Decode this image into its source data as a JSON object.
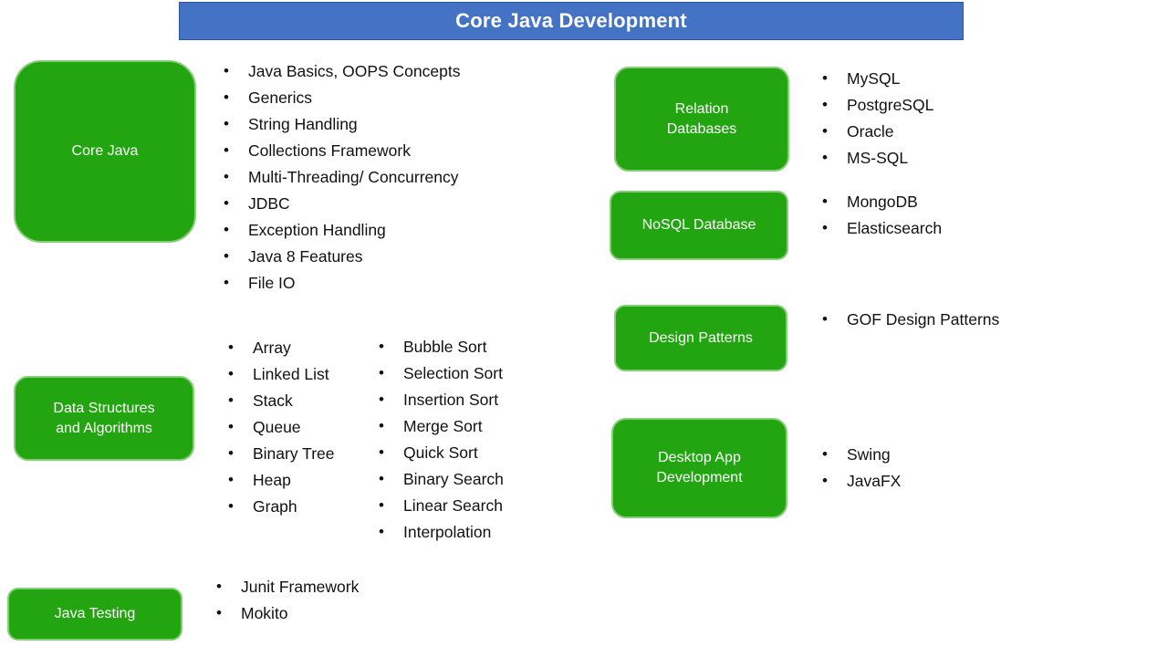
{
  "header": {
    "title": "Core Java Development",
    "background_color": "#4472c4",
    "text_color": "#ffffff"
  },
  "theme": {
    "box_fill": "#22a510",
    "box_border": "#86cd78",
    "box_text": "#ffffff",
    "body_text": "#111111",
    "page_background": "#ffffff"
  },
  "sections": [
    {
      "id": "core-java",
      "box_label": "Core Java",
      "items": [
        "Java Basics, OOPS Concepts",
        "Generics",
        "String Handling",
        "Collections Framework",
        "Multi-Threading/ Concurrency",
        "JDBC",
        "Exception Handling",
        "Java 8 Features",
        "File IO"
      ]
    },
    {
      "id": "data-structures-and-algorithms",
      "box_label": "Data Structures\nand Algorithms",
      "items": [
        "Array",
        "Linked List",
        "Stack",
        "Queue",
        "Binary Tree",
        "Heap",
        "Graph"
      ],
      "items_secondary": [
        "Bubble Sort",
        "Selection Sort",
        "Insertion Sort",
        "Merge Sort",
        "Quick Sort",
        "Binary Search",
        "Linear Search",
        "Interpolation"
      ]
    },
    {
      "id": "java-testing",
      "box_label": "Java Testing",
      "items": [
        "Junit Framework",
        "Mokito"
      ]
    },
    {
      "id": "relation-databases",
      "box_label": "Relation\nDatabases",
      "items": [
        "MySQL",
        "PostgreSQL",
        "Oracle",
        "MS-SQL"
      ]
    },
    {
      "id": "nosql-database",
      "box_label": "NoSQL Database",
      "items": [
        "MongoDB",
        "Elasticsearch"
      ]
    },
    {
      "id": "design-patterns",
      "box_label": "Design Patterns",
      "items": [
        "GOF Design Patterns"
      ]
    },
    {
      "id": "desktop-app-development",
      "box_label": "Desktop App\nDevelopment",
      "items": [
        "Swing",
        "JavaFX"
      ]
    }
  ]
}
